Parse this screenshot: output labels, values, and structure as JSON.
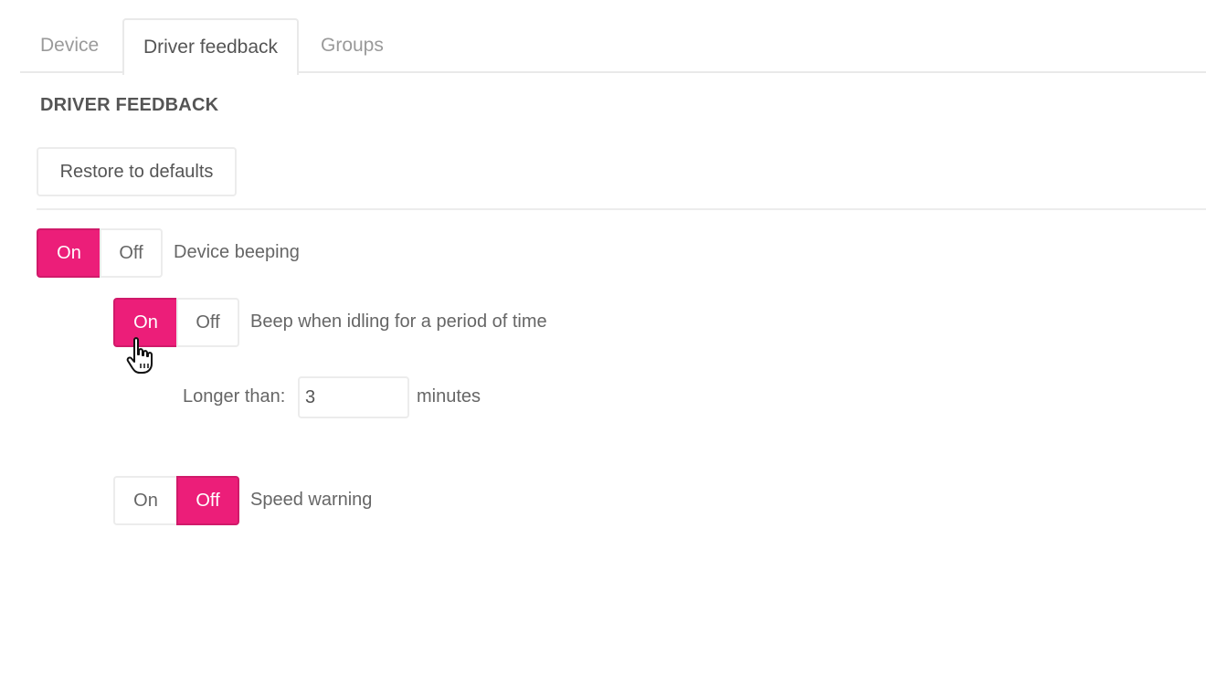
{
  "tabs": [
    {
      "label": "Device",
      "active": false
    },
    {
      "label": "Driver feedback",
      "active": true
    },
    {
      "label": "Groups",
      "active": false
    }
  ],
  "section": {
    "title": "DRIVER FEEDBACK",
    "restore_label": "Restore to defaults"
  },
  "settings": {
    "device_beeping": {
      "on_label": "On",
      "off_label": "Off",
      "label": "Device beeping",
      "state": "on"
    },
    "beep_idling": {
      "on_label": "On",
      "off_label": "Off",
      "label": "Beep when idling for a period of time",
      "state": "on"
    },
    "longer_than": {
      "label": "Longer than:",
      "value": "3",
      "unit": "minutes"
    },
    "speed_warning": {
      "on_label": "On",
      "off_label": "Off",
      "label": "Speed warning",
      "state": "off"
    }
  },
  "colors": {
    "accent": "#ec1e79",
    "border": "#ececec",
    "text": "#555555"
  },
  "icons": {
    "cursor": "hand-pointer-icon"
  }
}
